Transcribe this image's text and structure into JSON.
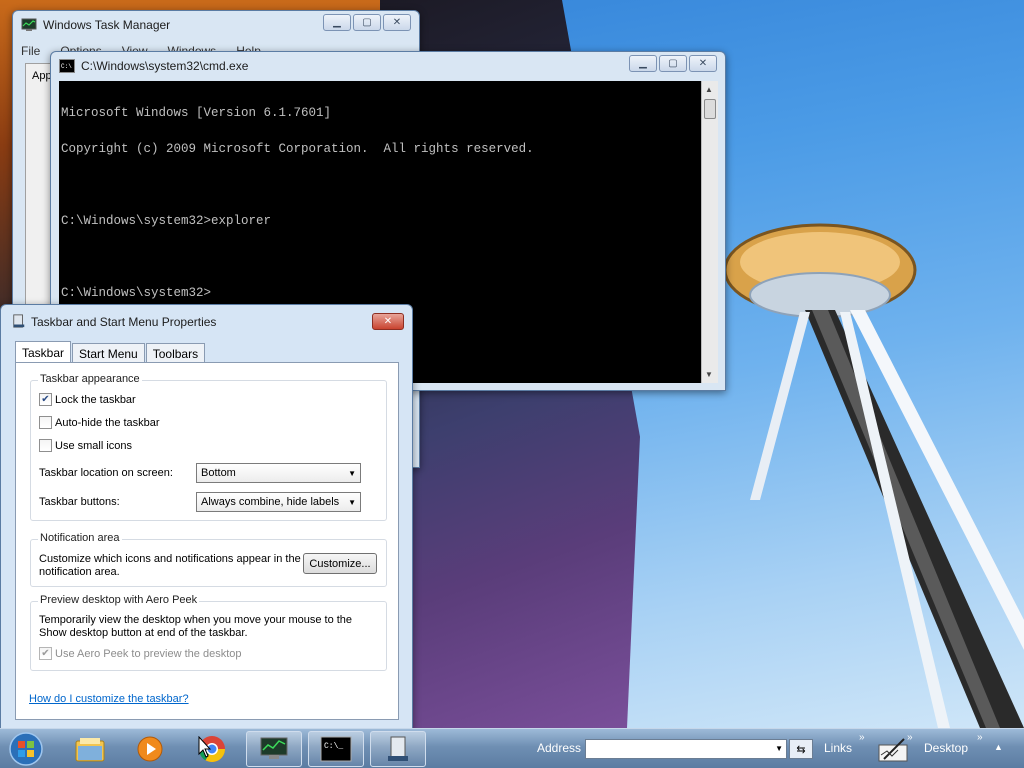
{
  "task_manager": {
    "title": "Windows Task Manager",
    "menu": [
      "File",
      "Options",
      "View",
      "Windows",
      "Help"
    ],
    "tab_partial": "App"
  },
  "cmd": {
    "title": "C:\\Windows\\system32\\cmd.exe",
    "lines": [
      "Microsoft Windows [Version 6.1.7601]",
      "Copyright (c) 2009 Microsoft Corporation.  All rights reserved.",
      "",
      "C:\\Windows\\system32>explorer",
      "",
      "C:\\Windows\\system32>"
    ]
  },
  "props": {
    "title": "Taskbar and Start Menu Properties",
    "tabs": [
      "Taskbar",
      "Start Menu",
      "Toolbars"
    ],
    "appearance": {
      "title": "Taskbar appearance",
      "lock": {
        "label": "Lock the taskbar",
        "checked": true
      },
      "autohide": {
        "label": "Auto-hide the taskbar",
        "checked": false
      },
      "smallicons": {
        "label": "Use small icons",
        "checked": false
      },
      "location_label": "Taskbar location on screen:",
      "location_value": "Bottom",
      "buttons_label": "Taskbar buttons:",
      "buttons_value": "Always combine, hide labels"
    },
    "notification": {
      "title": "Notification area",
      "desc_line1": "Customize which icons and notifications appear in the",
      "desc_line2": "notification area.",
      "button": "Customize..."
    },
    "aero": {
      "title": "Preview desktop with Aero Peek",
      "desc_line1": "Temporarily view the desktop when you move your mouse to the",
      "desc_line2": "Show desktop button at end of the taskbar.",
      "checkbox": {
        "label": "Use Aero Peek to preview the desktop",
        "checked": true,
        "disabled": true
      }
    },
    "help_link": "How do I customize the taskbar?"
  },
  "taskbar": {
    "address_label": "Address",
    "address_value": "",
    "links_label": "Links",
    "desktop_label": "Desktop",
    "items": [
      "explorer-folder",
      "media-player",
      "chrome",
      "task-manager",
      "cmd",
      "taskbar-properties"
    ]
  }
}
